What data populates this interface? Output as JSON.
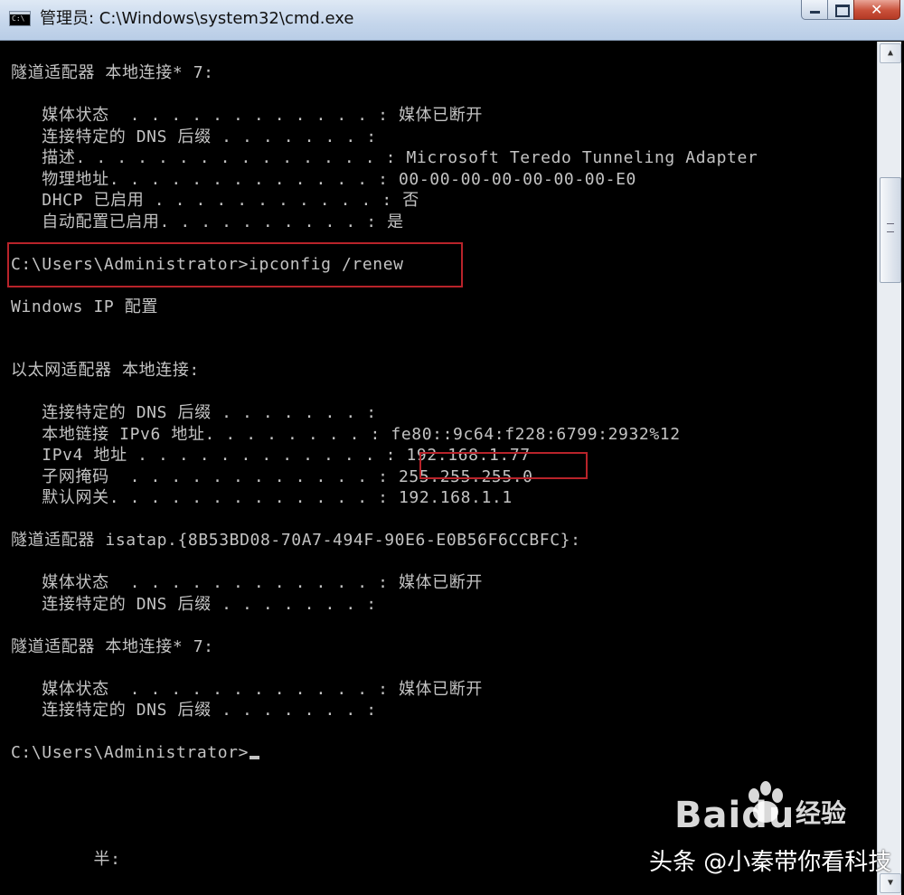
{
  "window": {
    "title": "管理员: C:\\Windows\\system32\\cmd.exe",
    "icon": "cmd-icon",
    "icon_label": "C:\\",
    "controls": {
      "minimize": "minimize-icon",
      "maximize": "maximize-icon",
      "close": "close-icon",
      "close_glyph": "✕"
    }
  },
  "console": {
    "lines": [
      "隧道适配器 本地连接* 7:",
      "",
      "   媒体状态  . . . . . . . . . . . . : 媒体已断开",
      "   连接特定的 DNS 后缀 . . . . . . . :",
      "   描述. . . . . . . . . . . . . . . : Microsoft Teredo Tunneling Adapter",
      "   物理地址. . . . . . . . . . . . . : 00-00-00-00-00-00-00-E0",
      "   DHCP 已启用 . . . . . . . . . . . : 否",
      "   自动配置已启用. . . . . . . . . . : 是",
      "",
      "C:\\Users\\Administrator>ipconfig /renew",
      "",
      "Windows IP 配置",
      "",
      "",
      "以太网适配器 本地连接:",
      "",
      "   连接特定的 DNS 后缀 . . . . . . . :",
      "   本地链接 IPv6 地址. . . . . . . . : fe80::9c64:f228:6799:2932%12",
      "   IPv4 地址 . . . . . . . . . . . . : 192.168.1.77",
      "   子网掩码  . . . . . . . . . . . . : 255.255.255.0",
      "   默认网关. . . . . . . . . . . . . : 192.168.1.1",
      "",
      "隧道适配器 isatap.{8B53BD08-70A7-494F-90E6-E0B56F6CCBFC}:",
      "",
      "   媒体状态  . . . . . . . . . . . . : 媒体已断开",
      "   连接特定的 DNS 后缀 . . . . . . . :",
      "",
      "隧道适配器 本地连接* 7:",
      "",
      "   媒体状态  . . . . . . . . . . . . : 媒体已断开",
      "   连接特定的 DNS 后缀 . . . . . . . :",
      "",
      "C:\\Users\\Administrator>",
      "",
      "",
      "",
      "",
      "        半:"
    ],
    "highlight_color": "#b8232a",
    "text_color": "#c3c3c3",
    "background": "#000000"
  },
  "scrollbar": {
    "up_icon": "scroll-up-icon",
    "down_icon": "scroll-down-icon"
  },
  "watermark": {
    "brand": "Baidu",
    "jingyan": "经验",
    "source": "头条 @小秦带你看科技"
  }
}
